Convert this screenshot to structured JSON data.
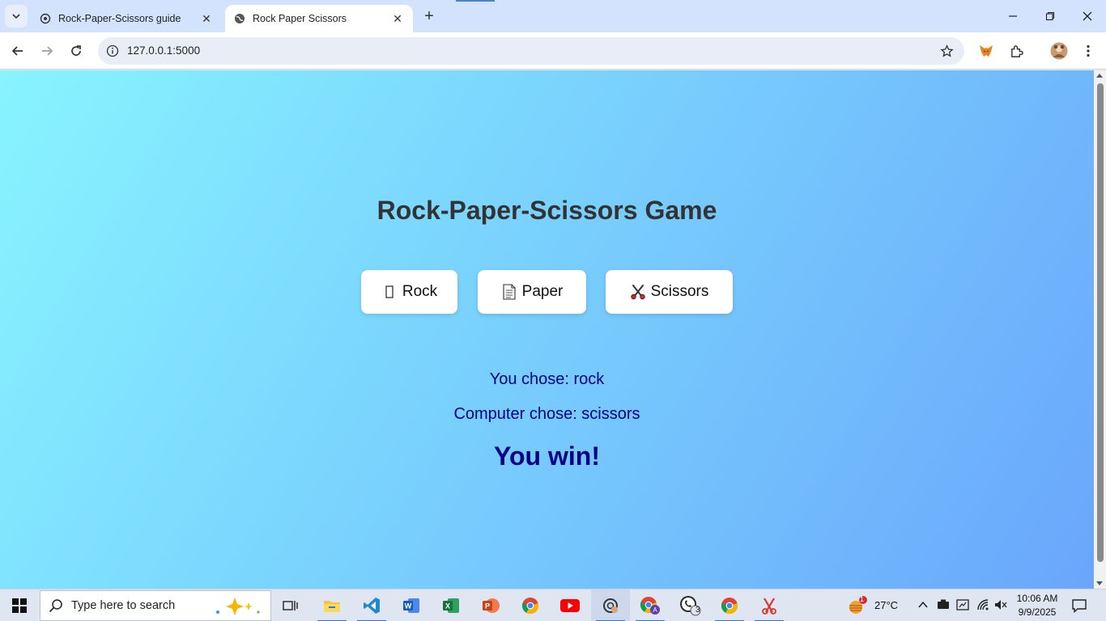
{
  "browser": {
    "tabs": [
      {
        "title": "Rock-Paper-Scissors guide",
        "active": false
      },
      {
        "title": "Rock Paper Scissors",
        "active": true
      }
    ],
    "url": "127.0.0.1:5000"
  },
  "game": {
    "title": "Rock-Paper-Scissors Game",
    "choices": [
      {
        "label": "Rock",
        "icon": "rock-emoji-icon"
      },
      {
        "label": "Paper",
        "icon": "page-emoji-icon"
      },
      {
        "label": "Scissors",
        "icon": "scissors-emoji-icon"
      }
    ],
    "you_chose": "You chose: rock",
    "computer_chose": "Computer chose: scissors",
    "outcome": "You win!"
  },
  "taskbar": {
    "search_placeholder": "Type here to search",
    "weather": "27°C",
    "weather_badge": "1",
    "whatsapp_badge": "3",
    "time": "10:06 AM",
    "date": "9/9/2025"
  },
  "colors": {
    "gradient_start": "#88f4ff",
    "gradient_end": "#6aa6fc",
    "title_text": "#333333",
    "result_text": "#00008b"
  }
}
